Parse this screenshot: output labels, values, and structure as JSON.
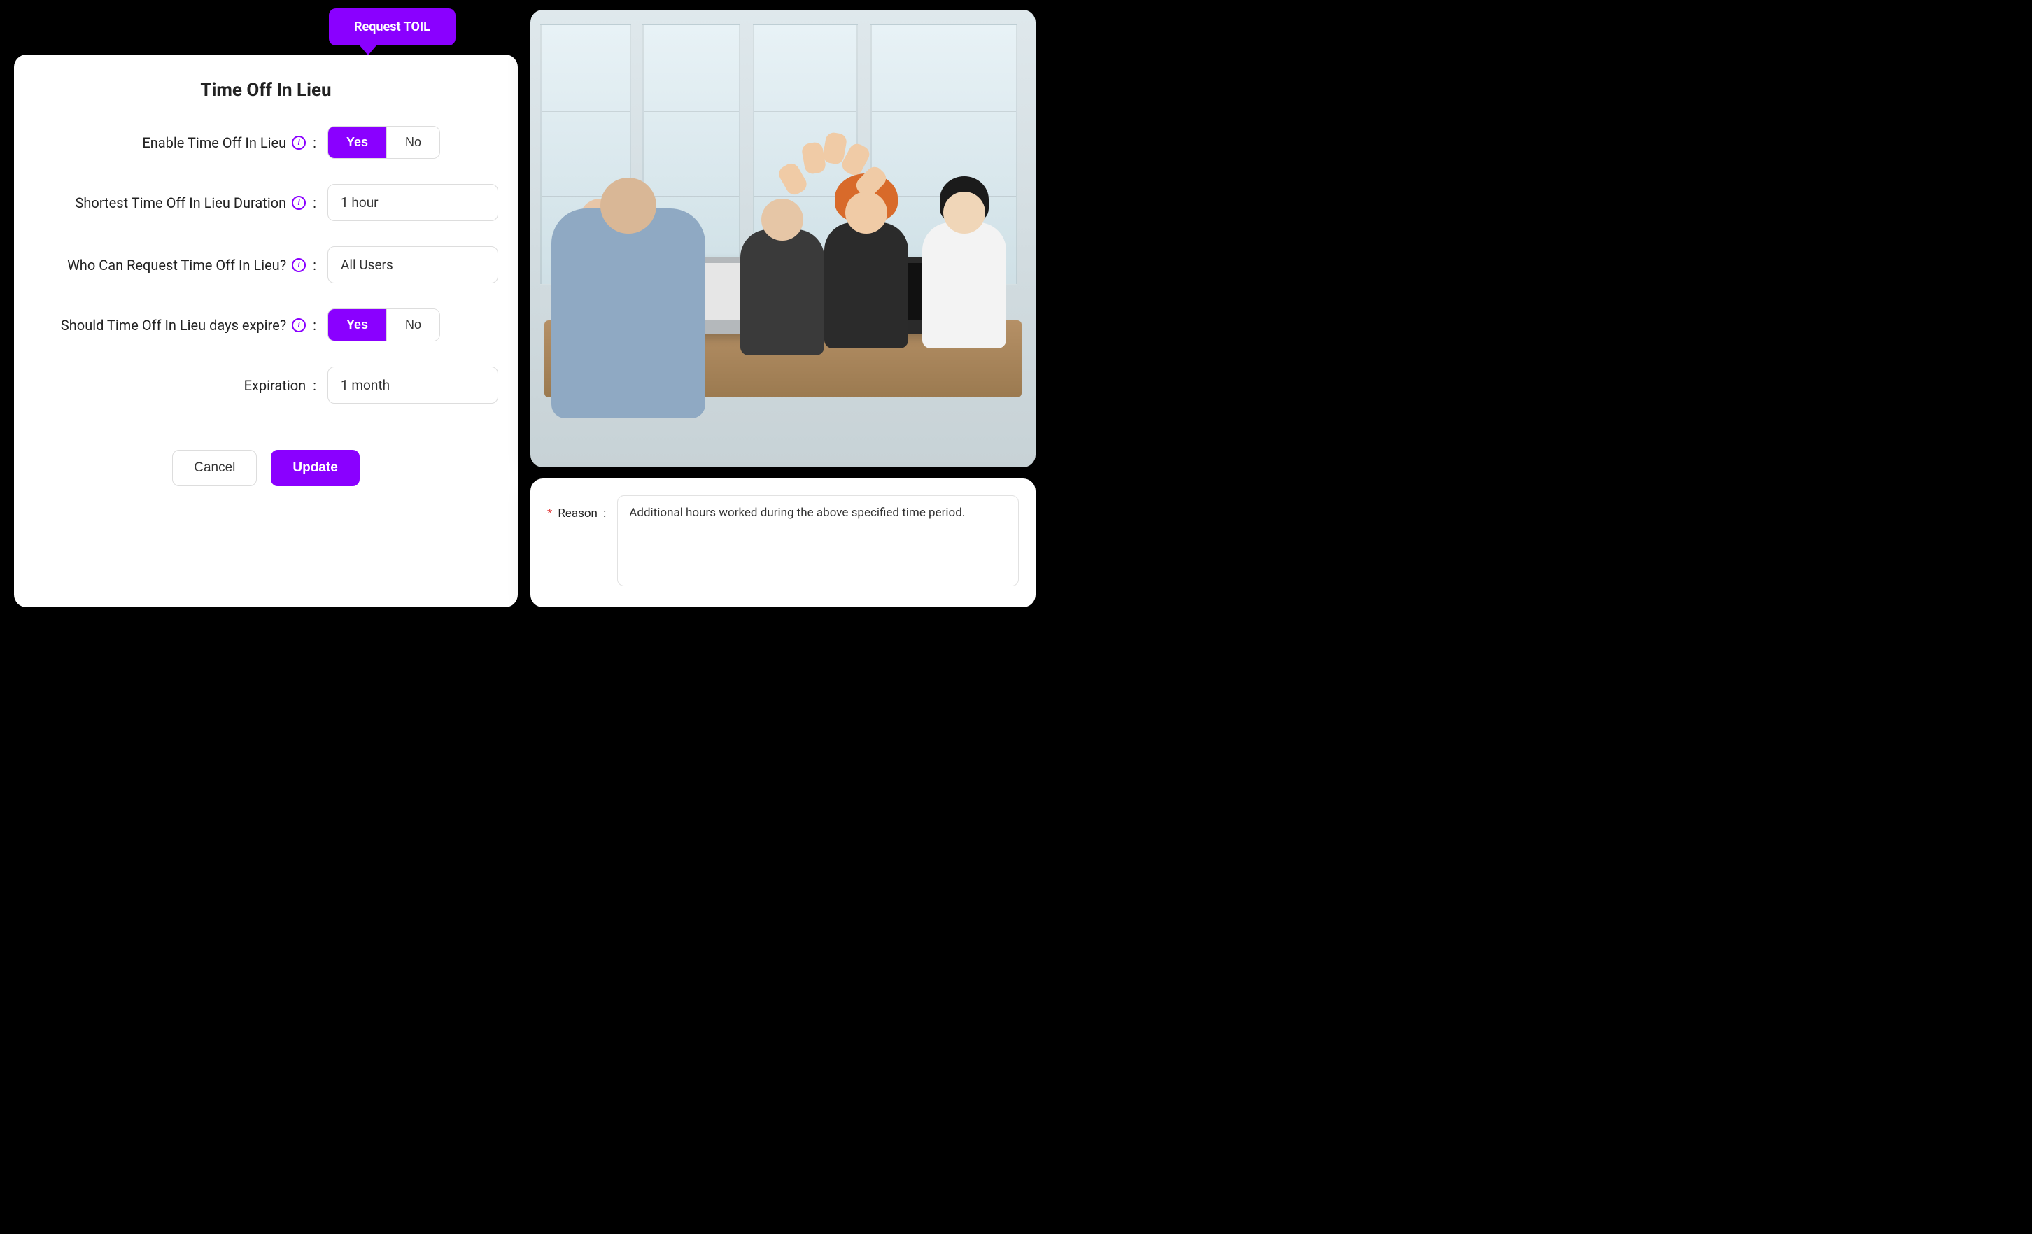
{
  "colors": {
    "accent": "#8A00FF"
  },
  "tooltip": {
    "label": "Request TOIL"
  },
  "settings": {
    "title": "Time Off In Lieu",
    "enable": {
      "label": "Enable Time Off In Lieu",
      "yes": "Yes",
      "no": "No",
      "selected": "yes"
    },
    "shortest": {
      "label": "Shortest Time Off In Lieu Duration",
      "value": "1 hour"
    },
    "who": {
      "label": "Who Can Request Time Off In Lieu?",
      "value": "All Users"
    },
    "expire": {
      "label": "Should Time Off In Lieu days expire?",
      "yes": "Yes",
      "no": "No",
      "selected": "yes"
    },
    "expiration": {
      "label": "Expiration",
      "value": "1 month"
    },
    "actions": {
      "cancel": "Cancel",
      "update": "Update"
    }
  },
  "reason": {
    "required_marker": "*",
    "label": "Reason",
    "value": "Additional hours worked during the above specified time period."
  }
}
